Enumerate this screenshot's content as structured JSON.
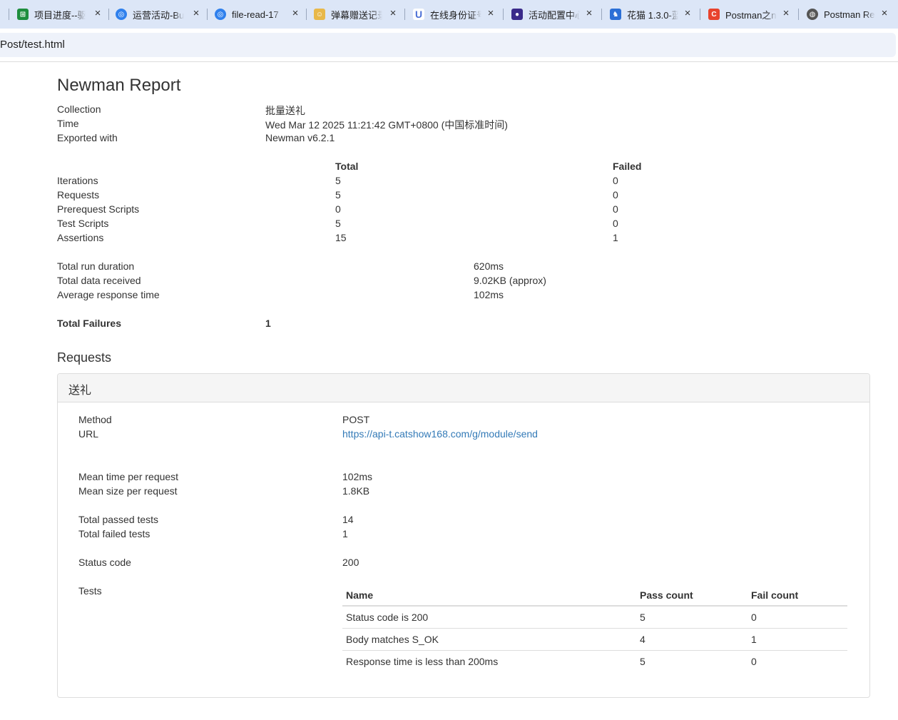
{
  "browser": {
    "tabs": [
      {
        "title": "项目进度--驱",
        "icon": "spreadsheet-icon",
        "color": "#1e8e3e"
      },
      {
        "title": "运营活动-Bu",
        "icon": "swirl-icon",
        "color": "#2f80ed"
      },
      {
        "title": "file-read-17",
        "icon": "swirl-icon",
        "color": "#2f80ed"
      },
      {
        "title": "弹幕赠送记录",
        "icon": "avatar-icon",
        "color": "#e8b84a"
      },
      {
        "title": "在线身份证号",
        "icon": "u-icon",
        "color": "#4a6fd6"
      },
      {
        "title": "活动配置中心",
        "icon": "planet-icon",
        "color": "#3a2a8a"
      },
      {
        "title": "花猫 1.3.0-蓝",
        "icon": "cat-icon",
        "color": "#2b6fd6"
      },
      {
        "title": "Postman之n",
        "icon": "c-icon",
        "color": "#e8432d"
      },
      {
        "title": "Postman Re",
        "icon": "globe-icon",
        "color": "#555555"
      }
    ],
    "address": "Post/test.html"
  },
  "report": {
    "title": "Newman Report",
    "meta": [
      {
        "label": "Collection",
        "value": "批量送礼"
      },
      {
        "label": "Time",
        "value": "Wed Mar 12 2025 11:21:42 GMT+0800 (中国标准时间)"
      },
      {
        "label": "Exported with",
        "value": "Newman v6.2.1"
      }
    ],
    "summary_headers": {
      "total": "Total",
      "failed": "Failed"
    },
    "summary": [
      {
        "label": "Iterations",
        "total": "5",
        "failed": "0"
      },
      {
        "label": "Requests",
        "total": "5",
        "failed": "0"
      },
      {
        "label": "Prerequest Scripts",
        "total": "0",
        "failed": "0"
      },
      {
        "label": "Test Scripts",
        "total": "5",
        "failed": "0"
      },
      {
        "label": "Assertions",
        "total": "15",
        "failed": "1"
      }
    ],
    "timings": [
      {
        "label": "Total run duration",
        "value": "620ms"
      },
      {
        "label": "Total data received",
        "value": "9.02KB (approx)"
      },
      {
        "label": "Average response time",
        "value": "102ms"
      }
    ],
    "total_failures": {
      "label": "Total Failures",
      "value": "1"
    },
    "requests_heading": "Requests",
    "request": {
      "name": "送礼",
      "method_label": "Method",
      "method": "POST",
      "url_label": "URL",
      "url": "https://api-t.catshow168.com/g/module/send",
      "mean_time_label": "Mean time per request",
      "mean_time": "102ms",
      "mean_size_label": "Mean size per request",
      "mean_size": "1.8KB",
      "passed_label": "Total passed tests",
      "passed": "14",
      "failed_label": "Total failed tests",
      "failed": "1",
      "status_label": "Status code",
      "status": "200",
      "tests_label": "Tests",
      "tests_headers": {
        "name": "Name",
        "pass": "Pass count",
        "fail": "Fail count"
      },
      "tests": [
        {
          "name": "Status code is 200",
          "pass": "5",
          "fail": "0"
        },
        {
          "name": "Body matches S_OK",
          "pass": "4",
          "fail": "1"
        },
        {
          "name": "Response time is less than 200ms",
          "pass": "5",
          "fail": "0"
        }
      ]
    }
  }
}
